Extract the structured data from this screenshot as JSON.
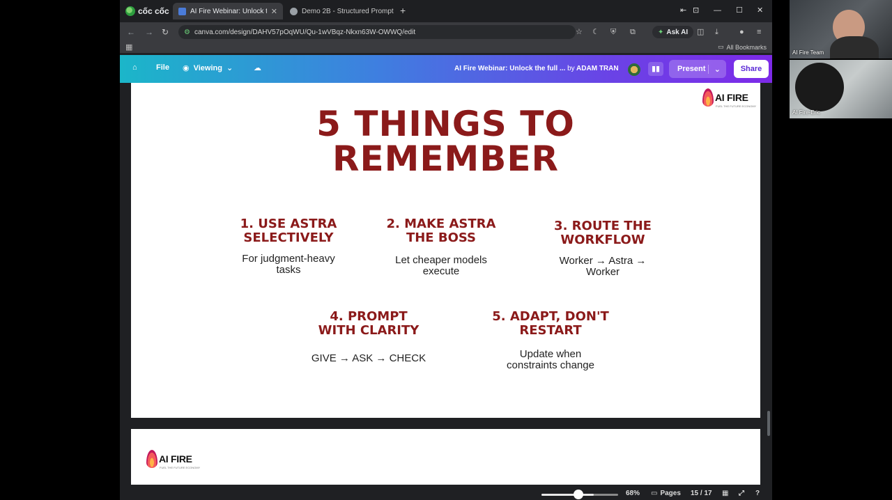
{
  "browser": {
    "brand": "cốc cốc",
    "tabs": [
      {
        "label": "AI Fire Webinar: Unlock the",
        "active": true
      },
      {
        "label": "Demo 2B - Structured Prompt",
        "active": false
      }
    ],
    "url": "canva.com/design/DAHV57pOqWU/Qu-1wVBqz-Nkxn63W-OWWQ/edit",
    "ask_ai": "Ask AI",
    "all_bookmarks": "All Bookmarks"
  },
  "canva": {
    "file": "File",
    "viewing": "Viewing",
    "doc_title": "AI Fire Webinar: Unlock the full ...",
    "by": "by",
    "author": "ADAM TRAN",
    "present": "Present",
    "share": "Share"
  },
  "slide": {
    "logo": "AI FIRE",
    "logo_tag": "FUEL THE FUTURE ECONOMY",
    "title_line1": "5 THINGS TO",
    "title_line2": "REMEMBER",
    "items": [
      {
        "head1": "1. USE ASTRA",
        "head2": "SELECTIVELY",
        "desc1": "For judgment-heavy",
        "desc2": "tasks"
      },
      {
        "head1": "2. MAKE ASTRA",
        "head2": "THE BOSS",
        "desc1": "Let cheaper models",
        "desc2": "execute"
      },
      {
        "head1": "3. ROUTE THE",
        "head2": "WORKFLOW",
        "desc1": "Worker → Astra →",
        "desc2": "Worker"
      },
      {
        "head1": "4. PROMPT",
        "head2": "WITH CLARITY",
        "desc1": "GIVE → ASK → CHECK",
        "desc2": ""
      },
      {
        "head1": "5. ADAPT, DON'T",
        "head2": "RESTART",
        "desc1": "Update when",
        "desc2": "constraints change"
      }
    ]
  },
  "slide2": {
    "logo": "AI FIRE",
    "logo_tag": "FUEL THE FUTURE ECONOMY"
  },
  "bottom": {
    "zoom": "68%",
    "zoom_value": 0.68,
    "pages_label": "Pages",
    "page_count": "15 / 17"
  },
  "video": {
    "tile1_name": "AI Fire Team",
    "tile2_name": "AI Fire-Eric"
  }
}
